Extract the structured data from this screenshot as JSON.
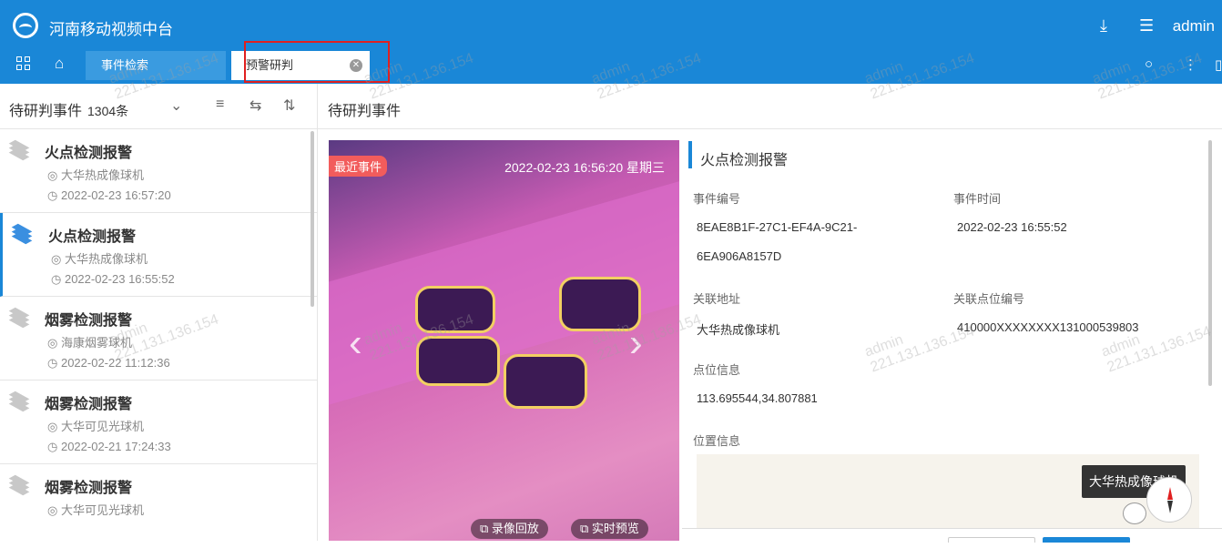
{
  "app": {
    "title": "河南移动视频中台",
    "user": "admin"
  },
  "tabs": [
    {
      "label": "事件检索"
    },
    {
      "label": "预警研判"
    }
  ],
  "left_panel": {
    "title": "待研判事件",
    "count": "1304条",
    "events": [
      {
        "title": "火点检测报警",
        "device": "大华热成像球机",
        "time": "2022-02-23 16:57:20"
      },
      {
        "title": "火点检测报警",
        "device": "大华热成像球机",
        "time": "2022-02-23 16:55:52"
      },
      {
        "title": "烟雾检测报警",
        "device": "海康烟雾球机",
        "time": "2022-02-22 11:12:36"
      },
      {
        "title": "烟雾检测报警",
        "device": "大华可见光球机",
        "time": "2022-02-21 17:24:33"
      },
      {
        "title": "烟雾检测报警",
        "device": "大华可见光球机",
        "time": ""
      }
    ]
  },
  "main": {
    "title": "待研判事件",
    "video": {
      "badge": "最近事件",
      "timestamp": "2022-02-23 16:56:20 星期三",
      "btn_playback": "录像回放",
      "btn_live": "实时预览"
    },
    "detail": {
      "title": "火点检测报警",
      "event_no_label": "事件编号",
      "event_no_line1": "8EAE8B1F-27C1-EF4A-9C21-",
      "event_no_line2": "6EA906A8157D",
      "event_time_label": "事件时间",
      "event_time": "2022-02-23 16:55:52",
      "address_label": "关联地址",
      "address": "大华热成像球机",
      "point_no_label": "关联点位编号",
      "point_no": "410000XXXXXXXX131000539803",
      "point_info_label": "点位信息",
      "point_info": "113.695544,34.807881",
      "location_label": "位置信息",
      "map_tooltip": "大华热成像球机"
    }
  },
  "watermark": {
    "line1": "admin",
    "line2": "221.131.136.154"
  },
  "colors": {
    "primary": "#1a87d7",
    "highlight": "#e02020",
    "badge": "#f25c5c"
  }
}
